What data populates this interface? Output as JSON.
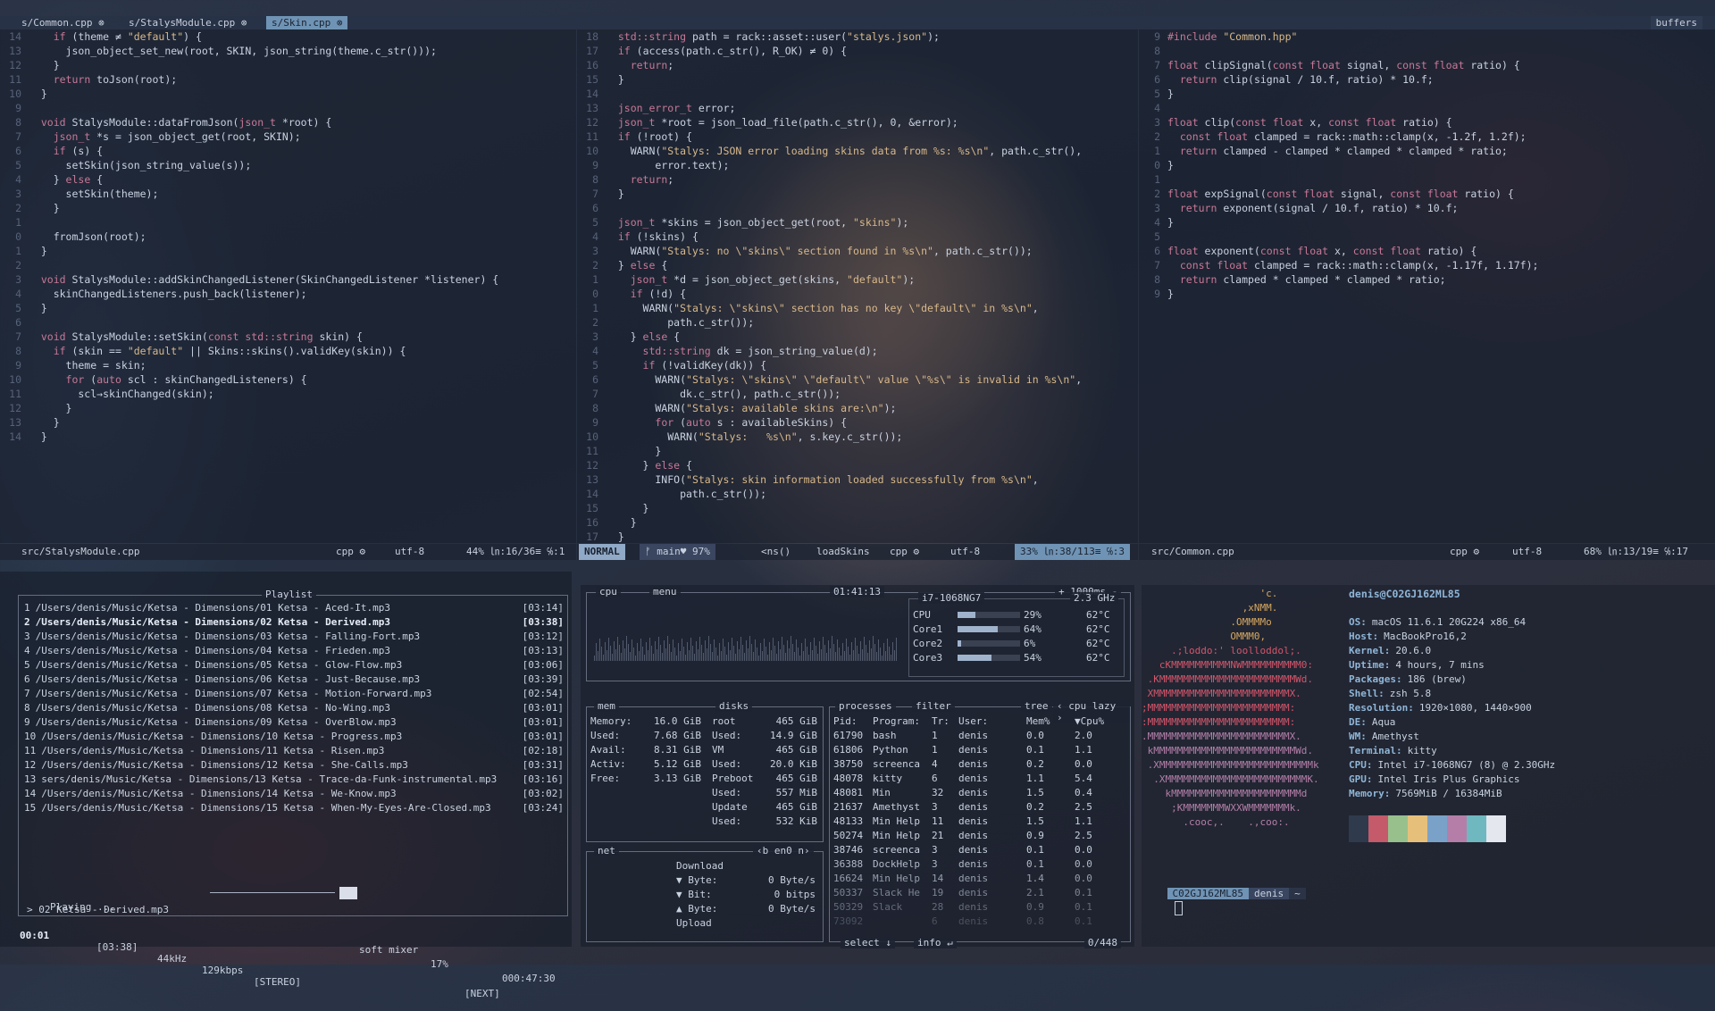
{
  "tabs": {
    "items": [
      {
        "label": "s/Common.cpp ⊗",
        "active": false
      },
      {
        "label": "s/StalysModule.cpp ⊗",
        "active": false
      },
      {
        "label": "s/Skin.cpp ⊗",
        "active": true
      }
    ],
    "buffers_label": "buffers"
  },
  "left_pane": {
    "lines": [
      "    if (theme ≠ \"default\") {",
      "      json_object_set_new(root, SKIN, json_string(theme.c_str()));",
      "    }",
      "    return toJson(root);",
      "  }",
      "",
      "  void StalysModule::dataFromJson(json_t *root) {",
      "    json_t *s = json_object_get(root, SKIN);",
      "    if (s) {",
      "      setSkin(json_string_value(s));",
      "    } else {",
      "      setSkin(theme);",
      "    }",
      "",
      "    fromJson(root);",
      "  }",
      "",
      "  void StalysModule::addSkinChangedListener(SkinChangedListener *listener) {",
      "    skinChangedListeners.push_back(listener);",
      "  }",
      "",
      "  void StalysModule::setSkin(const std::string skin) {",
      "    if (skin == \"default\" || Skins::skins().validKey(skin)) {",
      "      theme = skin;",
      "      for (auto scl : skinChangedListeners) {",
      "        scl→skinChanged(skin);",
      "      }",
      "    }",
      "  }"
    ],
    "status": {
      "file": "src/StalysModule.cpp",
      "ft": "cpp ⚙",
      "enc": "utf-8 ",
      "pos": "44% ㏑:16/36≡ ℅:1"
    }
  },
  "mid_pane": {
    "lines": [
      "  std::string path = rack::asset::user(\"stalys.json\");",
      "  if (access(path.c_str(), R_OK) ≠ 0) {",
      "    return;",
      "  }",
      "",
      "  json_error_t error;",
      "  json_t *root = json_load_file(path.c_str(), 0, &error);",
      "  if (!root) {",
      "    WARN(\"Stalys: JSON error loading skins data from %s: %s\\n\", path.c_str(),",
      "        error.text);",
      "    return;",
      "  }",
      "",
      "  json_t *skins = json_object_get(root, \"skins\");",
      "  if (!skins) {",
      "    WARN(\"Stalys: no \\\"skins\\\" section found in %s\\n\", path.c_str());",
      "  } else {",
      "    json_t *d = json_object_get(skins, \"default\");",
      "    if (!d) {",
      "      WARN(\"Stalys: \\\"skins\\\" section has no key \\\"default\\\" in %s\\n\",",
      "          path.c_str());",
      "    } else {",
      "      std::string dk = json_string_value(d);",
      "      if (!validKey(dk)) {",
      "        WARN(\"Stalys: \\\"skins\\\" \\\"default\\\" value \\\"%s\\\" is invalid in %s\\n\",",
      "            dk.c_str(), path.c_str());",
      "        WARN(\"Stalys: available skins are:\\n\");",
      "        for (auto s : availableSkins) {",
      "          WARN(\"Stalys:   %s\\n\", s.key.c_str());",
      "        }",
      "      } else {",
      "        INFO(\"Stalys: skin information loaded successfully from %s\\n\",",
      "            path.c_str());",
      "      }",
      "    }",
      "  }"
    ],
    "status": {
      "mode": "NORMAL",
      "branch": "ᚠ main♥ 97%",
      "crumb1": "<ns()",
      "crumb2": "loadSkins",
      "ft": "cpp ⚙",
      "enc": "utf-8 ",
      "pos": "33% ㏑:38/113≡ ℅:3"
    }
  },
  "right_pane": {
    "lines": [
      "#include \"Common.hpp\"",
      "",
      "float clipSignal(const float signal, const float ratio) {",
      "  return clip(signal / 10.f, ratio) * 10.f;",
      "}",
      "",
      "float clip(const float x, const float ratio) {",
      "  const float clamped = rack::math::clamp(x, -1.2f, 1.2f);",
      "  return clamped - clamped * clamped * clamped * ratio;",
      "}",
      "",
      "float expSignal(const float signal, const float ratio) {",
      "  return exponent(signal / 10.f, ratio) * 10.f;",
      "}",
      "",
      "float exponent(const float x, const float ratio) {",
      "  const float clamped = rack::math::clamp(x, -1.17f, 1.17f);",
      "  return clamped * clamped * clamped * ratio;",
      "}"
    ],
    "status": {
      "file": "src/Common.cpp",
      "ft": "cpp ⚙",
      "enc": "utf-8 ",
      "pos": "68% ㏑:13/19≡ ℅:17"
    }
  },
  "playlist": {
    "title": "Playlist",
    "items": [
      {
        "n": "1",
        "path": "/Users/denis/Music/Ketsa - Dimensions/01 Ketsa - Aced-It.mp3",
        "dur": "[03:14]"
      },
      {
        "n": "2",
        "path": "/Users/denis/Music/Ketsa - Dimensions/02 Ketsa - Derived.mp3",
        "dur": "[03:38]"
      },
      {
        "n": "3",
        "path": "/Users/denis/Music/Ketsa - Dimensions/03 Ketsa - Falling-Fort.mp3",
        "dur": "[03:12]"
      },
      {
        "n": "4",
        "path": "/Users/denis/Music/Ketsa - Dimensions/04 Ketsa - Frieden.mp3",
        "dur": "[03:13]"
      },
      {
        "n": "5",
        "path": "/Users/denis/Music/Ketsa - Dimensions/05 Ketsa - Glow-Flow.mp3",
        "dur": "[03:06]"
      },
      {
        "n": "6",
        "path": "/Users/denis/Music/Ketsa - Dimensions/06 Ketsa - Just-Because.mp3",
        "dur": "[03:39]"
      },
      {
        "n": "7",
        "path": "/Users/denis/Music/Ketsa - Dimensions/07 Ketsa - Motion-Forward.mp3",
        "dur": "[02:54]"
      },
      {
        "n": "8",
        "path": "/Users/denis/Music/Ketsa - Dimensions/08 Ketsa - No-Wing.mp3",
        "dur": "[03:01]"
      },
      {
        "n": "9",
        "path": "/Users/denis/Music/Ketsa - Dimensions/09 Ketsa - OverBlow.mp3",
        "dur": "[03:01]"
      },
      {
        "n": "10",
        "path": "/Users/denis/Music/Ketsa - Dimensions/10 Ketsa - Progress.mp3",
        "dur": "[03:01]"
      },
      {
        "n": "11",
        "path": "/Users/denis/Music/Ketsa - Dimensions/11 Ketsa - Risen.mp3",
        "dur": "[02:18]"
      },
      {
        "n": "12",
        "path": "/Users/denis/Music/Ketsa - Dimensions/12 Ketsa - She-Calls.mp3",
        "dur": "[03:31]"
      },
      {
        "n": "13",
        "path": "sers/denis/Music/Ketsa - Dimensions/13 Ketsa - Trace-da-Funk-instrumental.mp3",
        "dur": "[03:16]"
      },
      {
        "n": "14",
        "path": "/Users/denis/Music/Ketsa - Dimensions/14 Ketsa - We-Know.mp3",
        "dur": "[03:02]"
      },
      {
        "n": "15",
        "path": "/Users/denis/Music/Ketsa - Dimensions/15 Ketsa - When-My-Eyes-Are-Closed.mp3",
        "dur": "[03:24]"
      }
    ],
    "current_index": 1,
    "playing_label": "Playing ...",
    "mixer_label": "soft mixer",
    "volume": "17%",
    "total_time": "000:47:30",
    "now_playing": "> 02 Ketsa - Derived.mp3",
    "elapsed": "00:01",
    "duration": "[03:38]",
    "rate": "44kHz",
    "bitrate": "129kbps",
    "mode": "[STEREO]",
    "next": "[NEXT]"
  },
  "btop": {
    "cpu_tab": "cpu",
    "menu_tab": "menu",
    "clock": "01:41:13",
    "refresh": "+ 1000ms -",
    "cpu_model": "i7-1068NG7",
    "freq": "2.3 GHz",
    "cores": [
      {
        "name": "CPU",
        "pct": "29%",
        "temp": "62°C",
        "load": 0.29
      },
      {
        "name": "Core1",
        "pct": "64%",
        "temp": "62°C",
        "load": 0.64
      },
      {
        "name": "Core2",
        "pct": "6%",
        "temp": "62°C",
        "load": 0.06
      },
      {
        "name": "Core3",
        "pct": "54%",
        "temp": "62°C",
        "load": 0.54
      }
    ],
    "mem_title": "mem",
    "mem": [
      {
        "k": "Memory:",
        "v": "16.0 GiB"
      },
      {
        "k": "Used:",
        "v": "7.68 GiB"
      },
      {
        "k": "Avail:",
        "v": "8.31 GiB"
      },
      {
        "k": "Activ:",
        "v": "5.12 GiB"
      },
      {
        "k": "Free:",
        "v": "3.13 GiB"
      }
    ],
    "disks_title": "disks",
    "disks": [
      {
        "k": "root",
        "v": "465 GiB"
      },
      {
        "k": "Used:",
        "v": "14.9 GiB"
      },
      {
        "k": "VM",
        "v": "465 GiB"
      },
      {
        "k": "Used:",
        "v": "20.0 KiB"
      },
      {
        "k": "Preboot",
        "v": "465 GiB"
      },
      {
        "k": "Used:",
        "v": "557 MiB"
      },
      {
        "k": "Update",
        "v": "465 GiB"
      },
      {
        "k": "Used:",
        "v": "532 KiB"
      }
    ],
    "net_title": "net",
    "net_iface": "‹b en0 n›",
    "net": [
      {
        "k": "Download",
        "v": ""
      },
      {
        "k": "▼ Byte:",
        "v": "0 Byte/s"
      },
      {
        "k": "▼ Bit:",
        "v": "0 bitps"
      },
      {
        "k": "▲ Byte:",
        "v": "0 Byte/s"
      },
      {
        "k": "Upload",
        "v": ""
      }
    ],
    "proc_title": "processes",
    "proc_filter": "filter",
    "proc_tree": "tree",
    "proc_sort": "‹ cpu lazy ›",
    "proc_headers": [
      "Pid:",
      "Program:",
      "Tr:",
      "User:",
      "Mem%",
      "▼Cpu%"
    ],
    "procs": [
      [
        "61790",
        "bash",
        "1",
        "denis",
        "0.0",
        "2.0"
      ],
      [
        "61806",
        "Python",
        "1",
        "denis",
        "0.1",
        "1.1"
      ],
      [
        "38750",
        "screenca",
        "4",
        "denis",
        "0.2",
        "0.0"
      ],
      [
        "48078",
        "kitty",
        "6",
        "denis",
        "1.1",
        "5.4"
      ],
      [
        "48081",
        "Min",
        "32",
        "denis",
        "1.5",
        "0.4"
      ],
      [
        "21637",
        "Amethyst",
        "3",
        "denis",
        "0.2",
        "2.5"
      ],
      [
        "48133",
        "Min Help",
        "11",
        "denis",
        "1.5",
        "1.1"
      ],
      [
        "50274",
        "Min Help",
        "21",
        "denis",
        "0.9",
        "2.5"
      ],
      [
        "38746",
        "screenca",
        "3",
        "denis",
        "0.1",
        "0.0"
      ],
      [
        "36388",
        "DockHelp",
        "3",
        "denis",
        "0.1",
        "0.0"
      ],
      [
        "16624",
        "Min Help",
        "14",
        "denis",
        "1.4",
        "0.0"
      ],
      [
        "50337",
        "Slack He",
        "19",
        "denis",
        "2.1",
        "0.1"
      ],
      [
        "50329",
        "Slack",
        "28",
        "denis",
        "0.9",
        "0.1"
      ],
      [
        "73092",
        "",
        "6",
        "denis",
        "0.8",
        "0.1"
      ]
    ],
    "proc_select": "select ↓",
    "proc_info": "info ↵",
    "proc_count": "0/448"
  },
  "neofetch": {
    "logo": [
      "                    'c.",
      "                 ,xNMM.",
      "               .OMMMMo",
      "               OMMM0,",
      "     .;loddo:' loolloddol;.",
      "   cKMMMMMMMMMMNWMMMMMMMMMM0:",
      " .KMMMMMMMMMMMMMMMMMMMMMMMWd.",
      " XMMMMMMMMMMMMMMMMMMMMMMMX.",
      ";MMMMMMMMMMMMMMMMMMMMMMMM:",
      ":MMMMMMMMMMMMMMMMMMMMMMMM:",
      ".MMMMMMMMMMMMMMMMMMMMMMMMX.",
      " kMMMMMMMMMMMMMMMMMMMMMMMMWd.",
      " .XMMMMMMMMMMMMMMMMMMMMMMMMMMk",
      "  .XMMMMMMMMMMMMMMMMMMMMMMMMK.",
      "    kMMMMMMMMMMMMMMMMMMMMMMd",
      "     ;KMMMMMMMWXXWMMMMMMMk.",
      "       .cooc,.    .,coo:."
    ],
    "title": "denis@C02GJ162ML85",
    "info": [
      {
        "k": "OS:",
        "v": "macOS 11.6.1 20G224 x86_64"
      },
      {
        "k": "Host:",
        "v": "MacBookPro16,2"
      },
      {
        "k": "Kernel:",
        "v": "20.6.0"
      },
      {
        "k": "Uptime:",
        "v": "4 hours, 7 mins"
      },
      {
        "k": "Packages:",
        "v": "186 (brew)"
      },
      {
        "k": "Shell:",
        "v": "zsh 5.8"
      },
      {
        "k": "Resolution:",
        "v": "1920×1080, 1440×900"
      },
      {
        "k": "DE:",
        "v": "Aqua"
      },
      {
        "k": "WM:",
        "v": "Amethyst"
      },
      {
        "k": "Terminal:",
        "v": "kitty"
      },
      {
        "k": "CPU:",
        "v": "Intel i7-1068NG7 (8) @ 2.30GHz"
      },
      {
        "k": "GPU:",
        "v": "Intel Iris Plus Graphics"
      },
      {
        "k": "Memory:",
        "v": "7569MiB / 16384MiB"
      }
    ],
    "palette": [
      "#2f3a4c",
      "#c45a6a",
      "#98c08c",
      "#e6c07b",
      "#7aa2c8",
      "#b47ea8",
      "#6fb8c0",
      "#e4e8ee"
    ],
    "prompt_host": "C02GJ162ML85",
    "prompt_user": "denis",
    "prompt_dir": "~"
  }
}
